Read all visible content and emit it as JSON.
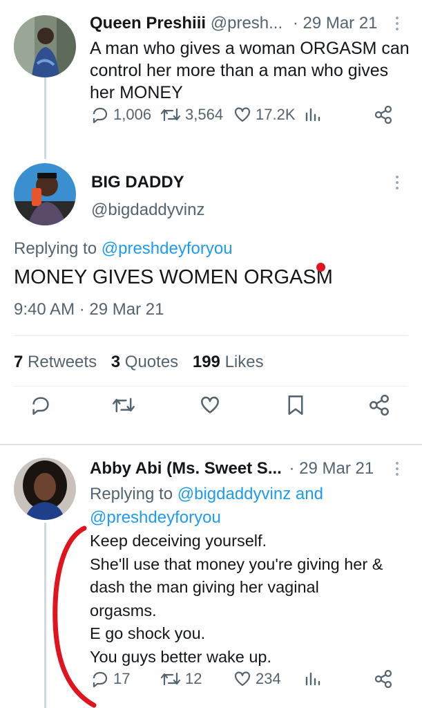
{
  "tweet1": {
    "name": "Queen Preshiii",
    "handle": "@presh...",
    "date": "· 29 Mar 21",
    "text": "A man who gives a woman ORGASM can control her more than a man who gives her MONEY",
    "replies": "1,006",
    "retweets": "3,564",
    "likes": "17.2K"
  },
  "tweet2": {
    "name": "BIG DADDY",
    "handle": "@bigdaddyvinz",
    "replying_prefix": "Replying to",
    "replying_to": "@preshdeyforyou",
    "text": "MONEY GIVES WOMEN ORGASM",
    "time": "9:40 AM · 29 Mar 21",
    "retweets_count": "7",
    "retweets_label": "Retweets",
    "quotes_count": "3",
    "quotes_label": "Quotes",
    "likes_count": "199",
    "likes_label": "Likes"
  },
  "tweet3": {
    "name": "Abby Abi (Ms. Sweet S...",
    "date": "· 29 Mar 21",
    "replying_prefix": "Replying to",
    "replying_to_1": "@bigdaddyvinz",
    "replying_and": "and",
    "replying_to_2": "@preshdeyforyou",
    "lines": [
      "Keep deceiving yourself.",
      "She'll use that money you're giving her &",
      "dash the man giving her vaginal",
      "orgasms.",
      "E go shock you.",
      "You guys better wake up."
    ],
    "replies": "17",
    "retweets": "12",
    "likes": "234"
  },
  "colors": {
    "link": "#1d9bf0",
    "muted": "#536471",
    "annotation_red": "#e0141e"
  },
  "icons": [
    "reply-icon",
    "retweet-icon",
    "like-icon",
    "analytics-icon",
    "share-icon",
    "bookmark-icon",
    "more-icon"
  ]
}
